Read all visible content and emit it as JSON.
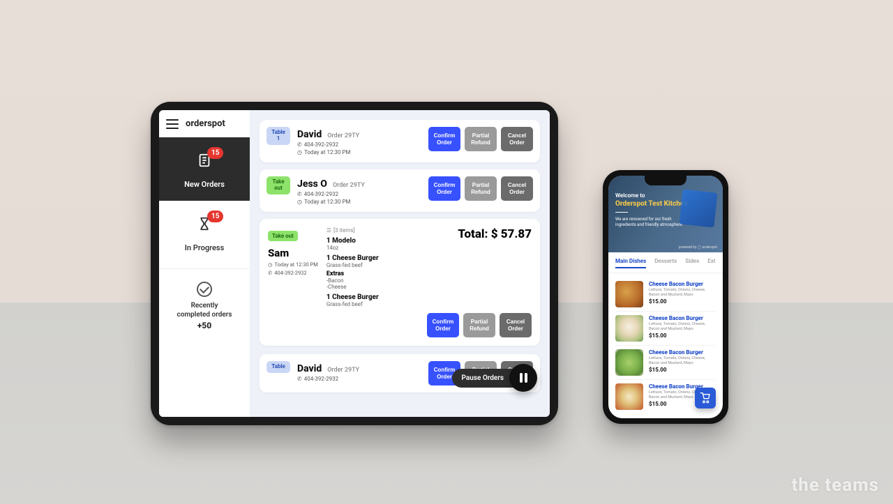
{
  "watermark": "the teams",
  "tablet": {
    "brand": "orderspot",
    "nav": {
      "new": {
        "label": "New Orders",
        "badge": "15"
      },
      "progress": {
        "label": "In Progress",
        "badge": "15"
      },
      "completed": {
        "label1": "Recently",
        "label2": "completed orders",
        "count": "+50"
      }
    },
    "actions": {
      "confirm": "Confirm\nOrder",
      "partial": "Partial\nRefund",
      "cancel": "Cancel\nOrder"
    },
    "orders": [
      {
        "tag": "Table\n1",
        "tagColor": "blue",
        "name": "David",
        "code": "Order 29TY",
        "phone": "404-392-2932",
        "time": "Today at 12:30 PM"
      },
      {
        "tag": "Take\nout",
        "tagColor": "green",
        "name": "Jess O",
        "code": "Order 29TY",
        "phone": "404-392-2932",
        "time": "Today at 12:30 PM"
      }
    ],
    "expanded": {
      "tag": "Take out",
      "name": "Sam",
      "time": "Today at 12:30 PM",
      "phone": "404-392-2932",
      "items_count": "[3 items]",
      "total_label": "Total:",
      "total_value": "$ 57.87",
      "items": [
        {
          "title": "1 Modelo",
          "sub": "14oz"
        },
        {
          "title": "1 Cheese Burger",
          "sub": "Grass-fed beef",
          "extras_h": "Extras",
          "extras": [
            "-Bacon",
            "-Cheese"
          ]
        },
        {
          "title": "1 Cheese Burger",
          "sub": "Grass-fed beef"
        }
      ]
    },
    "peek": {
      "tag": "Table",
      "name": "David",
      "code": "Order 29TY",
      "phone": "404-392-2932"
    },
    "pause_label": "Pause Orders"
  },
  "phone": {
    "hero": {
      "welcome": "Welcome to",
      "title": "Orderspot Test Kitchen",
      "sub": "We are renowned for our fresh ingredients and friendly atmosphere",
      "powered": "powered by ◯ orderspot"
    },
    "tabs": [
      "Main Dishes",
      "Desserts",
      "Sides",
      "Ext"
    ],
    "item_template": {
      "name": "Cheese Bacon Burger",
      "desc": "Lettuce, Tomato, Onions, Cheese, Bacon and Mustard, Mayo",
      "price": "$15.00"
    }
  }
}
